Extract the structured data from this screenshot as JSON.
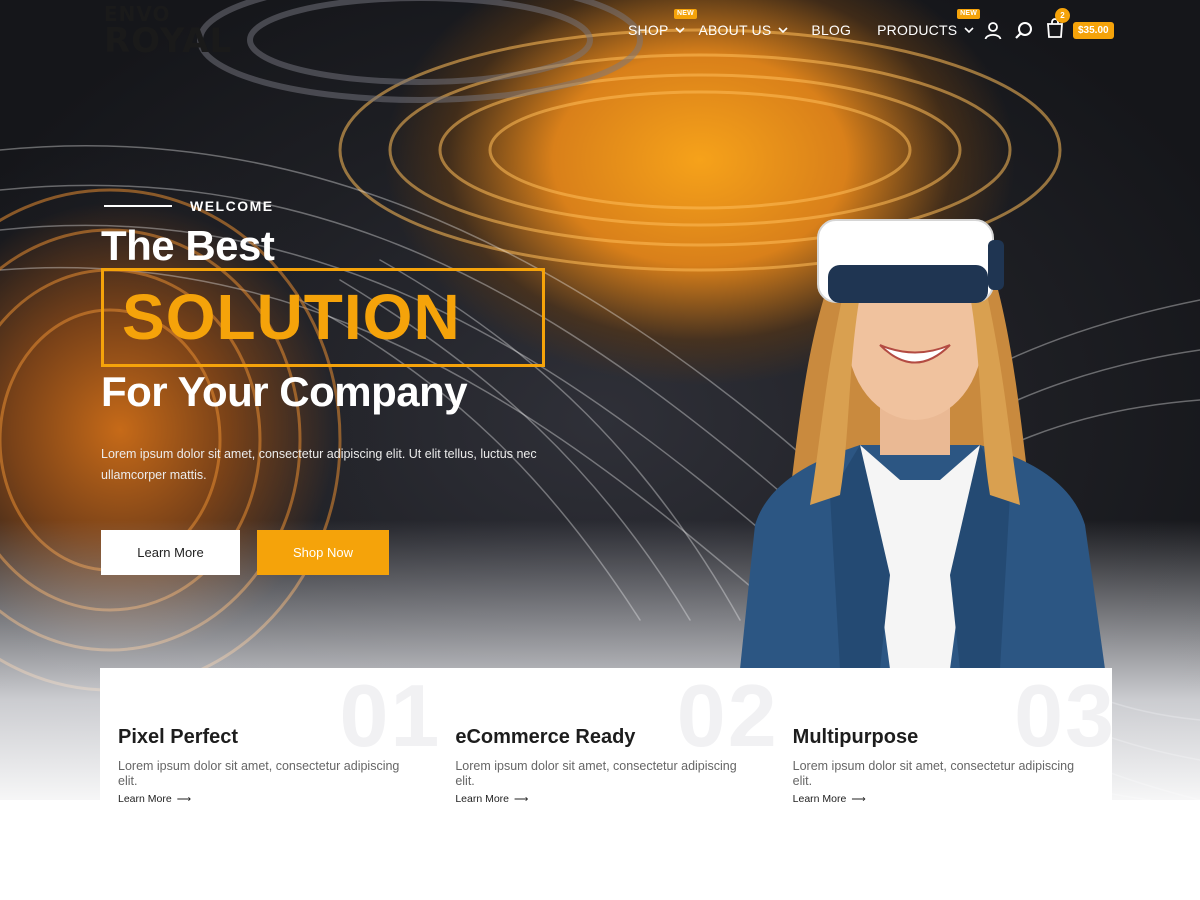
{
  "logo": {
    "line1": "ENVO",
    "line2": "ROYAL"
  },
  "nav": {
    "items": [
      {
        "label": "SHOP",
        "badge": "NEW",
        "has_dropdown": true
      },
      {
        "label": "ABOUT US",
        "badge": "",
        "has_dropdown": true
      },
      {
        "label": "BLOG",
        "badge": "",
        "has_dropdown": false
      },
      {
        "label": "PRODUCTS",
        "badge": "NEW",
        "has_dropdown": true
      }
    ],
    "icons": [
      "user-icon",
      "search-icon",
      "cart-icon"
    ],
    "cart_count": "2",
    "cart_total": "$35.00"
  },
  "hero": {
    "welcome": "WELCOME",
    "line1": "The Best",
    "highlight": "SOLUTION",
    "line3": "For Your Company",
    "paragraph": "Lorem ipsum dolor sit amet, consectetur adipiscing elit. Ut elit tellus, luctus nec ullamcorper mattis.",
    "btn_learn": "Learn More",
    "btn_shop": "Shop Now"
  },
  "features": [
    {
      "num": "01",
      "title": "Pixel Perfect",
      "text": "Lorem ipsum dolor sit amet, consectetur adipiscing elit.",
      "link": "Learn More"
    },
    {
      "num": "02",
      "title": "eCommerce Ready",
      "text": "Lorem ipsum dolor sit amet, consectetur adipiscing elit.",
      "link": "Learn More"
    },
    {
      "num": "03",
      "title": "Multipurpose",
      "text": "Lorem ipsum dolor sit amet, consectetur adipiscing elit.",
      "link": "Learn More"
    }
  ],
  "colors": {
    "accent": "#f5a30a",
    "dark": "#1d1d1d",
    "white": "#ffffff"
  }
}
